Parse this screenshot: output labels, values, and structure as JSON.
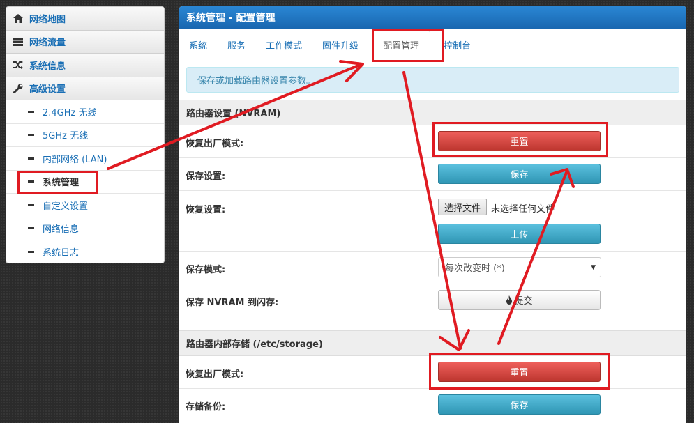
{
  "sidebar": {
    "top_items": [
      {
        "label": "网络地图",
        "icon": "home-icon"
      },
      {
        "label": "网络流量",
        "icon": "storage-icon"
      },
      {
        "label": "系统信息",
        "icon": "shuffle-icon"
      },
      {
        "label": "高级设置",
        "icon": "wrench-icon"
      }
    ],
    "sub_items": [
      {
        "label": "2.4GHz 无线"
      },
      {
        "label": "5GHz 无线"
      },
      {
        "label": "内部网络 (LAN)"
      },
      {
        "label": "系统管理"
      },
      {
        "label": "自定义设置"
      },
      {
        "label": "网络信息"
      },
      {
        "label": "系统日志"
      }
    ]
  },
  "main": {
    "title": "系统管理 - 配置管理",
    "tabs": [
      "系统",
      "服务",
      "工作模式",
      "固件升级",
      "配置管理",
      "控制台"
    ],
    "alert": "保存或加载路由器设置参数。",
    "nvram_section": {
      "title": "路由器设置 (NVRAM)",
      "factory_reset_label": "恢复出厂模式:",
      "reset_button": "重置",
      "save_settings_label": "保存设置:",
      "save_button": "保存",
      "restore_label": "恢复设置:",
      "choose_file_button": "选择文件",
      "no_file_text": "未选择任何文件",
      "upload_button": "上传",
      "save_mode_label": "保存模式:",
      "save_mode_value": "每次改变时 (*)",
      "flash_label": "保存 NVRAM 到闪存:",
      "commit_button": "提交"
    },
    "storage_section": {
      "title": "路由器内部存储 (/etc/storage)",
      "factory_reset_label": "恢复出厂模式:",
      "reset_button": "重置",
      "backup_label": "存储备份:",
      "save_button": "保存"
    }
  },
  "colors": {
    "link_blue": "#1a6fb5",
    "header_blue": "#1e73be",
    "danger_red": "#d9534f",
    "info_blue": "#5bc0de",
    "annotation_red": "#e01b22"
  }
}
